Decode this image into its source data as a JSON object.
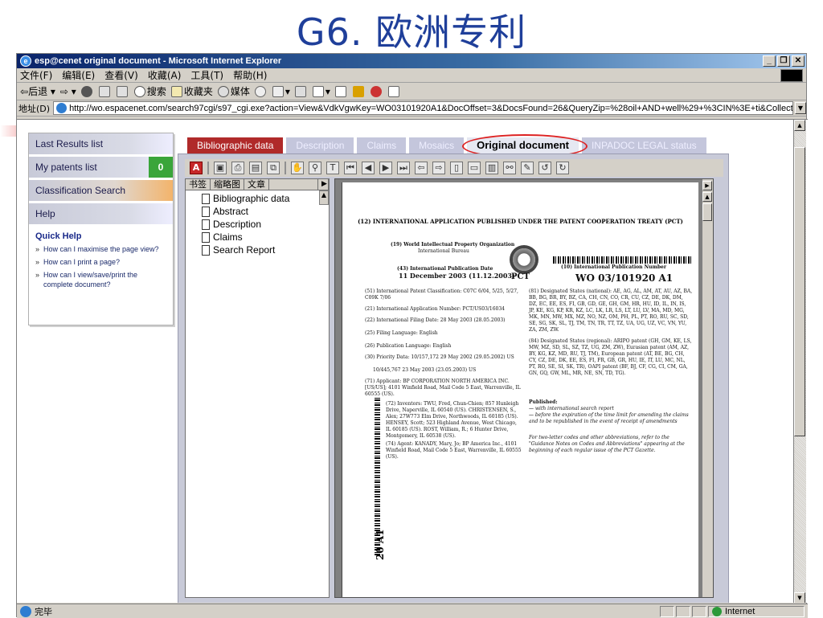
{
  "slide": {
    "title": "G6. 欧洲专利"
  },
  "window": {
    "title": "esp@cenet original document - Microsoft Internet Explorer"
  },
  "menu": [
    "文件(F)",
    "编辑(E)",
    "查看(V)",
    "收藏(A)",
    "工具(T)",
    "帮助(H)"
  ],
  "toolbar": {
    "back": "后退",
    "search": "搜索",
    "favorites": "收藏夹",
    "media": "媒体"
  },
  "address": {
    "label": "地址(D)",
    "url": "http://wo.espacenet.com/search97cgi/s97_cgi.exe?action=View&VdkVgwKey=WO03101920A1&DocOffset=3&DocsFound=26&QueryZip=%28oil+AND+well%29+%3CIN%3E+ti&Collection=di"
  },
  "nav": {
    "items": [
      {
        "label": "Last Results list"
      },
      {
        "label": "My patents list",
        "badge": "0"
      },
      {
        "label": "Classification Search"
      },
      {
        "label": "Help"
      }
    ],
    "quick_help_title": "Quick Help",
    "quick_help": [
      "How can I maximise the page view?",
      "How can I print a page?",
      "How can I view/save/print the complete document?"
    ]
  },
  "tabs": [
    "Bibliographic data",
    "Description",
    "Claims",
    "Mosaics",
    "Original document",
    "INPADOC LEGAL status"
  ],
  "bookmarks": {
    "tabs": [
      "书签",
      "缩略图",
      "文章"
    ],
    "items": [
      "Bibliographic data",
      "Abstract",
      "Description",
      "Claims",
      "Search Report"
    ]
  },
  "pdf": {
    "heading": "(12) INTERNATIONAL APPLICATION PUBLISHED UNDER THE PATENT COOPERATION TREATY (PCT)",
    "org": "(19) World Intellectual Property Organization",
    "bureau": "International Bureau",
    "pub_date_label": "(43) International Publication Date",
    "pub_date": "11 December 2003 (11.12.2003)",
    "pct": "PCT",
    "pub_num_label": "(10) International Publication Number",
    "pub_num": "WO 03/101920 A1",
    "left_fields": [
      "(51) International Patent Classification: C07C 6/04, 5/25, 5/27, C09K 7/06",
      "(21) International Application Number: PCT/US03/16034",
      "(22) International Filing Date: 28 May 2003 (28.05.2003)",
      "(25) Filing Language: English",
      "(26) Publication Language: English",
      "(30) Priority Data: 10/157,172  29 May 2002 (29.05.2002) US",
      "10/445,767  23 May 2003 (23.05.2003) US",
      "(71) Applicant: BP CORPORATION NORTH AMERICA INC. [US/US]; 4101 Winfield Road, Mail Code 5 East, Warrenville, IL 60555 (US).",
      "(72) Inventors: TWU, Fred, Chun-Chien; 857 Hunleigh Drive, Naperville, IL 60540 (US). CHRISTENSEN, S., Alex; 27W773 Elm Drive, Northwoods, IL 60185 (US). HENSEY, Scott; 523 Highland Avenue, West Chicago, IL 60185 (US). ROST, William, R.; 6 Hunter Drive, Montgomery, IL 60538 (US).",
      "(74) Agent: KANADY, Mary, Jo; BP America Inc., 4101 Winfield Road, Mail Code 5 East, Warrenville, IL 60555 (US)."
    ],
    "right_fields": [
      "(81) Designated States (national): AE, AG, AL, AM, AT, AU, AZ, BA, BB, BG, BR, BY, BZ, CA, CH, CN, CO, CR, CU, CZ, DE, DK, DM, DZ, EC, EE, ES, FI, GB, GD, GE, GH, GM, HR, HU, ID, IL, IN, IS, JP, KE, KG, KP, KR, KZ, LC, LK, LR, LS, LT, LU, LV, MA, MD, MG, MK, MN, MW, MX, MZ, NO, NZ, OM, PH, PL, PT, RO, RU, SC, SD, SE, SG, SK, SL, TJ, TM, TN, TR, TT, TZ, UA, UG, UZ, VC, VN, YU, ZA, ZM, ZW.",
      "(84) Designated States (regional): ARIPO patent (GH, GM, KE, LS, MW, MZ, SD, SL, SZ, TZ, UG, ZM, ZW), Eurasian patent (AM, AZ, BY, KG, KZ, MD, RU, TJ, TM), European patent (AT, BE, BG, CH, CY, CZ, DE, DK, EE, ES, FI, FR, GB, GR, HU, IE, IT, LU, MC, NL, PT, RO, SE, SI, SK, TR), OAPI patent (BF, BJ, CF, CG, CI, CM, GA, GN, GQ, GW, ML, MR, NE, SN, TD, TG).",
      "Published:",
      "— with international search report",
      "— before the expiration of the time limit for amending the claims and to be republished in the event of receipt of amendments",
      "For two-letter codes and other abbreviations, refer to the \"Guidance Notes on Codes and Abbreviations\" appearing at the beginning of each regular issue of the PCT Gazette."
    ],
    "side_code": "20 A1"
  },
  "status": {
    "text": "完毕",
    "zone": "Internet"
  }
}
